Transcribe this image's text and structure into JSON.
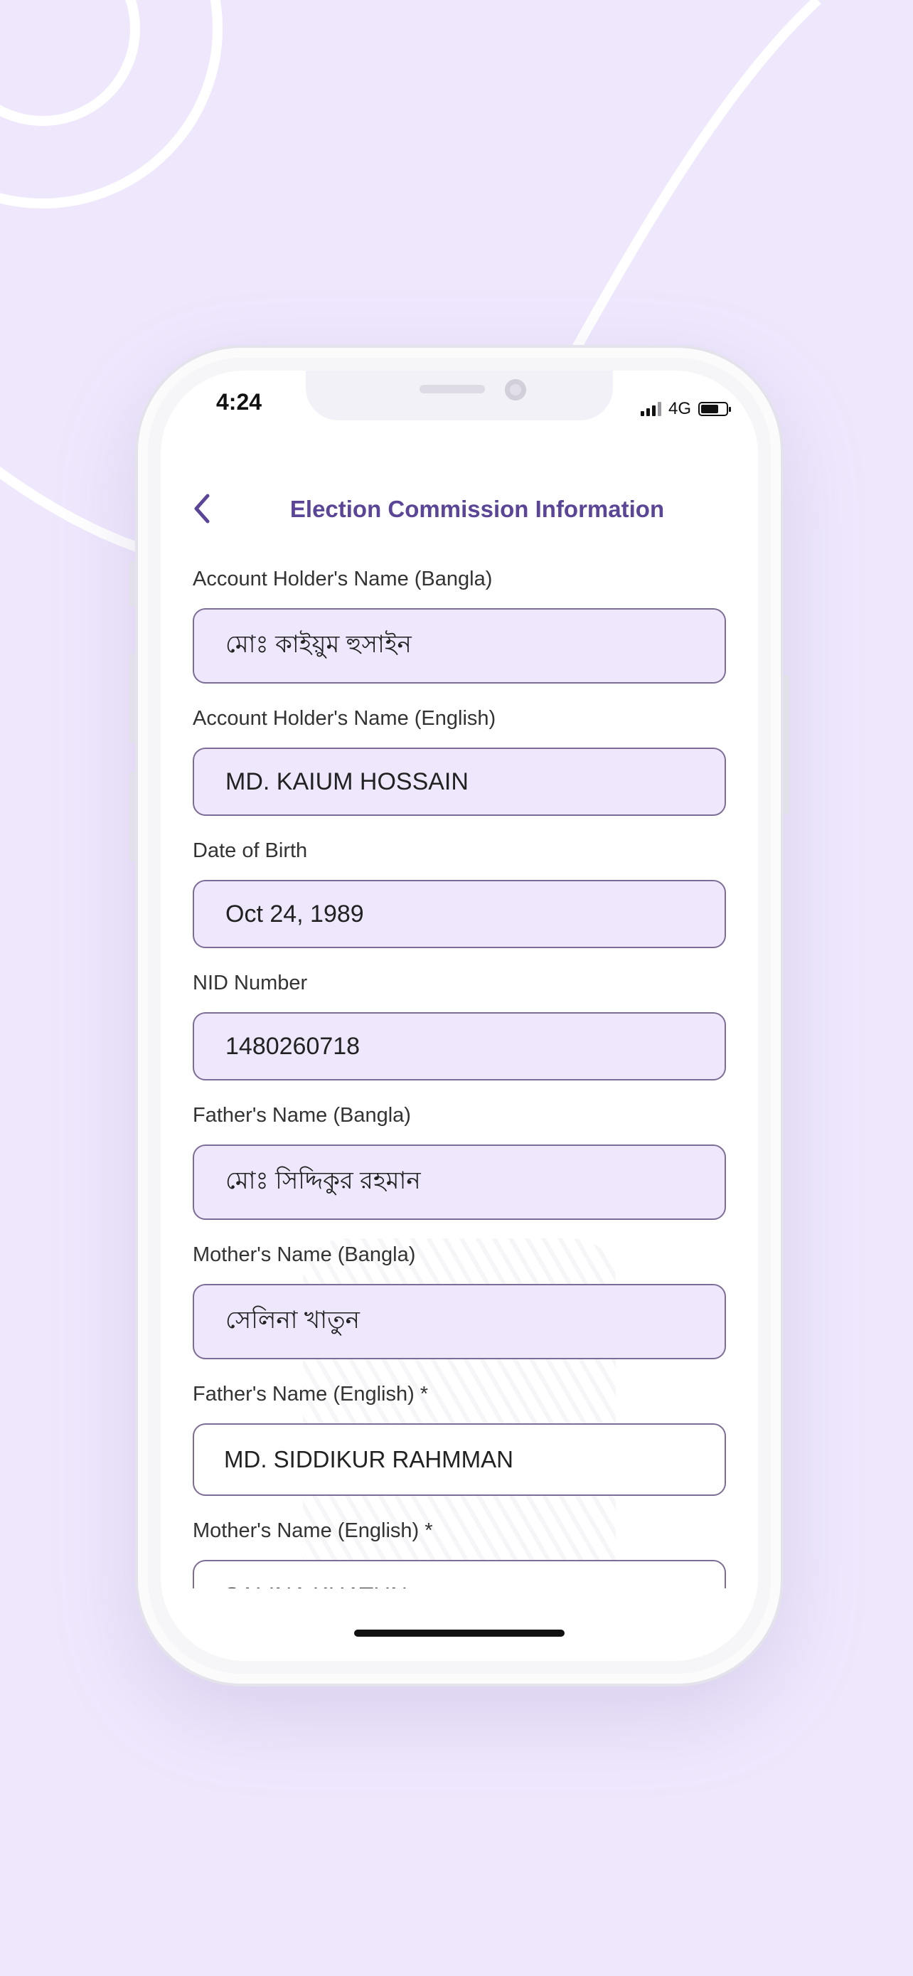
{
  "status_bar": {
    "time": "4:24",
    "network": "4G",
    "battery_level": 0.7
  },
  "header": {
    "title": "Election Commission Information",
    "back_icon": "chevron-left-icon"
  },
  "colors": {
    "accent": "#5b4597",
    "field_bg": "#efe8fd",
    "field_border": "#7d6d96",
    "page_bg": "#efe8fd"
  },
  "fields": [
    {
      "label": "Account Holder's Name (Bangla)",
      "value": "মোঃ কাইয়ুম হুসাইন"
    },
    {
      "label": "Account Holder's Name (English)",
      "value": "MD. KAIUM HOSSAIN"
    },
    {
      "label": "Date of Birth",
      "value": "Oct 24, 1989"
    },
    {
      "label": "NID Number",
      "value": "1480260718"
    },
    {
      "label": "Father's Name (Bangla)",
      "value": "মোঃ সিদ্দিকুর রহমান"
    },
    {
      "label": "Mother's Name (Bangla)",
      "value": "সেলিনা খাতুন"
    },
    {
      "label": "Father's Name (English) *",
      "value": "MD. SIDDIKUR RAHMMAN"
    },
    {
      "label": "Mother's Name (English) *",
      "value": "SALINA KHATUN"
    }
  ]
}
